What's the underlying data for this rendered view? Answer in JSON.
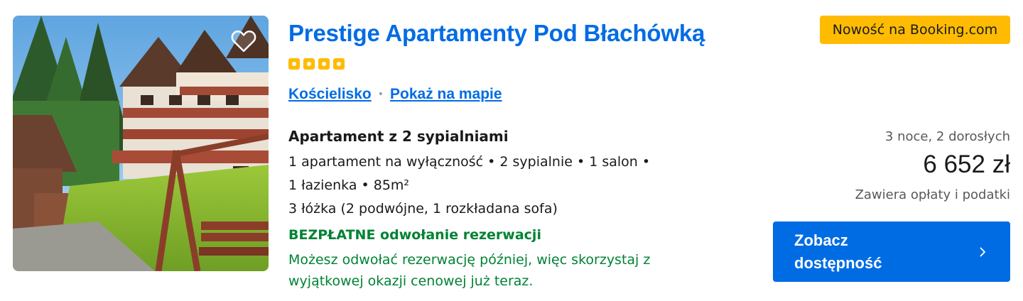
{
  "property": {
    "name": "Prestige Apartamenty Pod Błachówką",
    "stars": 4,
    "location": "Kościelisko",
    "map_link": "Pokaż na mapie",
    "photo_alt": "Prestige Apartamenty Pod Błachówką"
  },
  "badge": {
    "label": "Nowość na Booking.com"
  },
  "room": {
    "name": "Apartament z 2 sypialniami",
    "line1": "1 apartament na wyłączność • 2 sypialnie • 1 salon •",
    "line2": "1 łazienka • 85m²",
    "line3": "3 łóżka (2 podwójne, 1 rozkładana sofa)"
  },
  "cancellation": {
    "title": "BEZPŁATNE odwołanie rezerwacji",
    "description": "Możesz odwołać rezerwację później, więc skorzystaj z wyjątkowej okazji cenowej już teraz."
  },
  "pricing": {
    "stay_info": "3 noce, 2 dorosłych",
    "price": "6 652 zł",
    "taxes_note": "Zawiera opłaty i podatki"
  },
  "cta": {
    "label": "Zobacz dostępność",
    "icon": "chevron-right-icon"
  },
  "icons": {
    "favorite": "heart-outline-icon"
  },
  "colors": {
    "accent": "#006ce4",
    "star": "#febb02",
    "success": "#008234",
    "badge": "#febb02"
  }
}
